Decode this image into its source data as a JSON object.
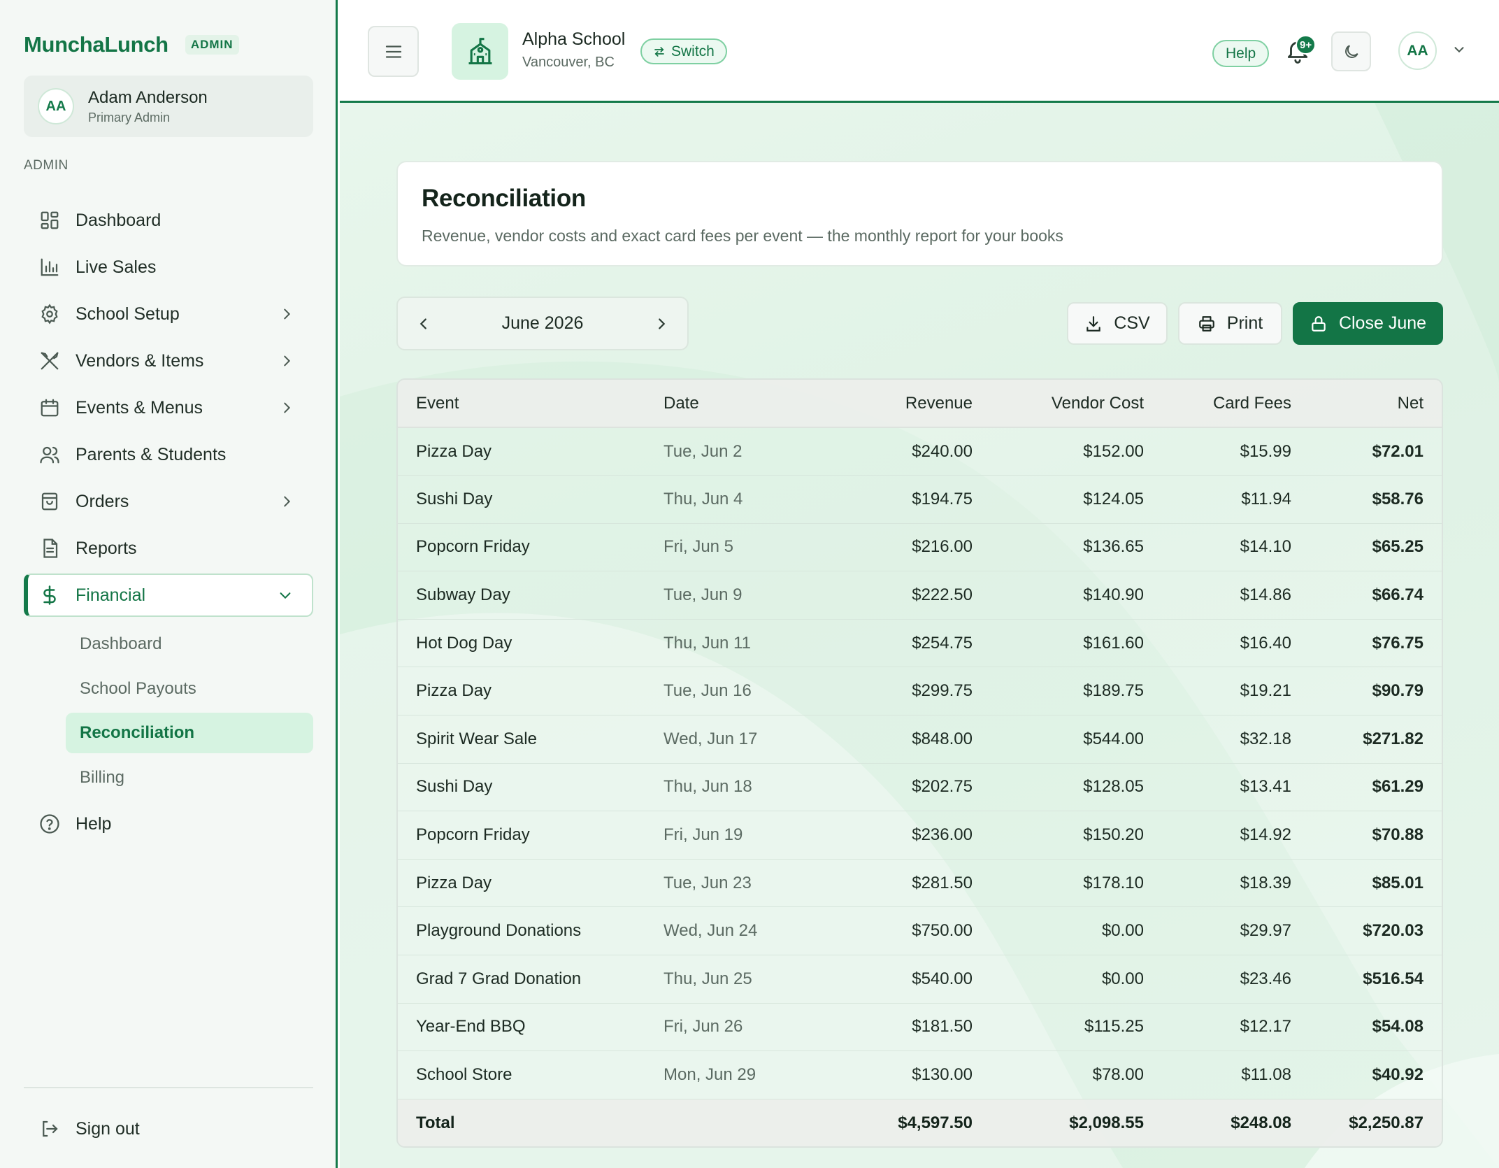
{
  "app": {
    "name": "MunchaLunch",
    "badge": "ADMIN"
  },
  "user": {
    "initials": "AA",
    "name": "Adam Anderson",
    "role": "Primary Admin"
  },
  "sidebar": {
    "section_label": "ADMIN",
    "items": [
      {
        "label": "Dashboard",
        "icon": "dashboard-icon"
      },
      {
        "label": "Live Sales",
        "icon": "bar-chart-icon"
      },
      {
        "label": "School Setup",
        "icon": "gear-icon"
      },
      {
        "label": "Vendors & Items",
        "icon": "utensils-icon"
      },
      {
        "label": "Events & Menus",
        "icon": "calendar-icon"
      },
      {
        "label": "Parents & Students",
        "icon": "users-icon"
      },
      {
        "label": "Orders",
        "icon": "shopping-bag-icon"
      },
      {
        "label": "Reports",
        "icon": "document-icon"
      },
      {
        "label": "Financial",
        "icon": "dollar-icon"
      },
      {
        "label": "Help",
        "icon": "help-circle-icon"
      }
    ],
    "financial_sub": [
      "Dashboard",
      "School Payouts",
      "Reconciliation",
      "Billing"
    ],
    "active_sub": "Reconciliation",
    "sign_out": "Sign out"
  },
  "topbar": {
    "school_name": "Alpha School",
    "school_city": "Vancouver, BC",
    "switch_label": "Switch",
    "help_label": "Help",
    "notification_count": "9+",
    "avatar_initials": "AA"
  },
  "page": {
    "title": "Reconciliation",
    "subtitle": "Revenue, vendor costs and exact card fees per event — the monthly report for your books"
  },
  "month_picker": {
    "label": "June 2026"
  },
  "actions": {
    "csv": "CSV",
    "print": "Print",
    "close": "Close June"
  },
  "colors": {
    "accent": "#137546",
    "accent_light": "#d6f3e1"
  },
  "table": {
    "headers": [
      "Event",
      "Date",
      "Revenue",
      "Vendor Cost",
      "Card Fees",
      "Net"
    ],
    "rows": [
      [
        "Pizza Day",
        "Tue, Jun 2",
        "$240.00",
        "$152.00",
        "$15.99",
        "$72.01"
      ],
      [
        "Sushi Day",
        "Thu, Jun 4",
        "$194.75",
        "$124.05",
        "$11.94",
        "$58.76"
      ],
      [
        "Popcorn Friday",
        "Fri, Jun 5",
        "$216.00",
        "$136.65",
        "$14.10",
        "$65.25"
      ],
      [
        "Subway Day",
        "Tue, Jun 9",
        "$222.50",
        "$140.90",
        "$14.86",
        "$66.74"
      ],
      [
        "Hot Dog Day",
        "Thu, Jun 11",
        "$254.75",
        "$161.60",
        "$16.40",
        "$76.75"
      ],
      [
        "Pizza Day",
        "Tue, Jun 16",
        "$299.75",
        "$189.75",
        "$19.21",
        "$90.79"
      ],
      [
        "Spirit Wear Sale",
        "Wed, Jun 17",
        "$848.00",
        "$544.00",
        "$32.18",
        "$271.82"
      ],
      [
        "Sushi Day",
        "Thu, Jun 18",
        "$202.75",
        "$128.05",
        "$13.41",
        "$61.29"
      ],
      [
        "Popcorn Friday",
        "Fri, Jun 19",
        "$236.00",
        "$150.20",
        "$14.92",
        "$70.88"
      ],
      [
        "Pizza Day",
        "Tue, Jun 23",
        "$281.50",
        "$178.10",
        "$18.39",
        "$85.01"
      ],
      [
        "Playground Donations",
        "Wed, Jun 24",
        "$750.00",
        "$0.00",
        "$29.97",
        "$720.03"
      ],
      [
        "Grad 7 Grad Donation",
        "Thu, Jun 25",
        "$540.00",
        "$0.00",
        "$23.46",
        "$516.54"
      ],
      [
        "Year-End BBQ",
        "Fri, Jun 26",
        "$181.50",
        "$115.25",
        "$12.17",
        "$54.08"
      ],
      [
        "School Store",
        "Mon, Jun 29",
        "$130.00",
        "$78.00",
        "$11.08",
        "$40.92"
      ]
    ],
    "total": [
      "Total",
      "",
      "$4,597.50",
      "$2,098.55",
      "$248.08",
      "$2,250.87"
    ]
  }
}
